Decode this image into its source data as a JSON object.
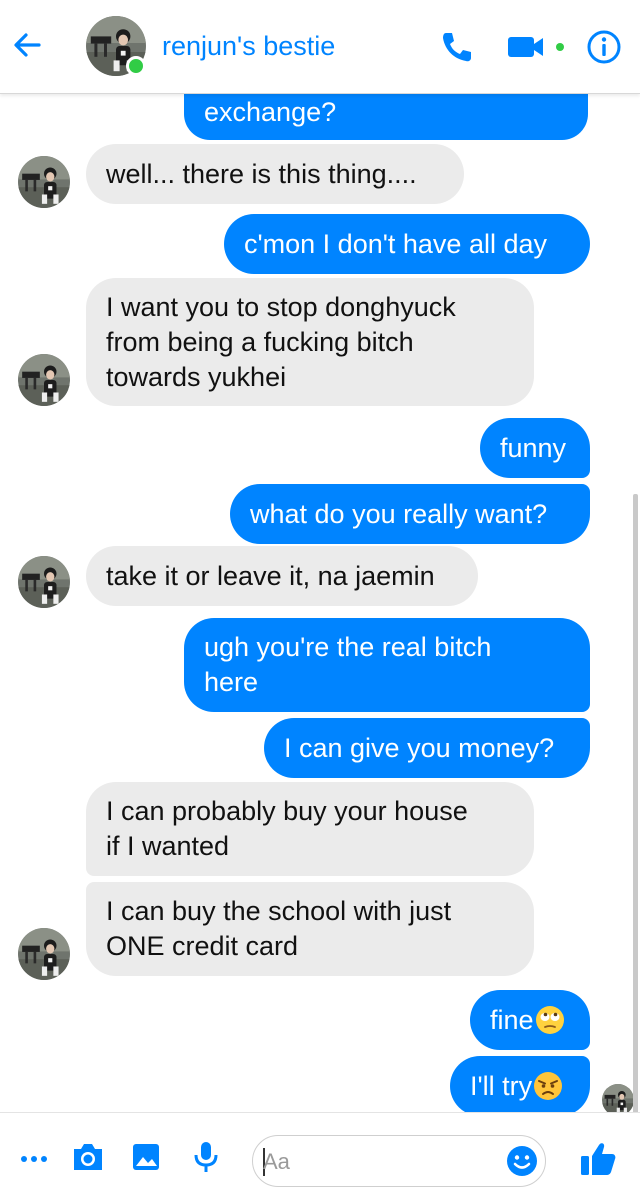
{
  "header": {
    "title": "renjun's bestie",
    "back_icon": "arrow-left-icon",
    "call_icon": "phone-icon",
    "video_icon": "video-camera-icon",
    "info_icon": "info-icon"
  },
  "colors": {
    "accent": "#0084ff",
    "incoming_bubble": "#ebebeb",
    "online": "#31cc46"
  },
  "messages": [
    {
      "from": "me",
      "text": "exchange?"
    },
    {
      "from": "them",
      "text": "well... there is this thing...."
    },
    {
      "from": "me",
      "text": "c'mon I don't have all day"
    },
    {
      "from": "them",
      "text": "I want you to stop donghyuck\nfrom being a fucking bitch\ntowards yukhei"
    },
    {
      "from": "me",
      "text": "funny"
    },
    {
      "from": "me",
      "text": "what do you really want?"
    },
    {
      "from": "them",
      "text": "take it or leave it, na jaemin"
    },
    {
      "from": "me",
      "text": "ugh you're the real bitch\nhere"
    },
    {
      "from": "me",
      "text": "I can give you money?"
    },
    {
      "from": "them",
      "text": "I can probably buy your house\nif I wanted"
    },
    {
      "from": "them",
      "text": "I can buy the school with just\nONE credit card"
    },
    {
      "from": "me",
      "text": "fine",
      "emoji": "eye-roll-emoji"
    },
    {
      "from": "me",
      "text": "I'll try",
      "emoji": "angry-face-emoji"
    }
  ],
  "composer": {
    "placeholder": "Aa",
    "more_icon": "more-dots-icon",
    "camera_icon": "camera-icon",
    "gallery_icon": "image-icon",
    "mic_icon": "microphone-icon",
    "emoji_icon": "smiley-icon",
    "like_icon": "thumbs-up-icon"
  }
}
